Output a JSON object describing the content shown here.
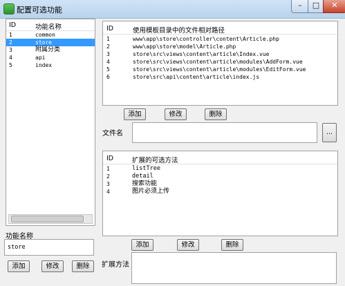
{
  "window": {
    "title": "配置可选功能"
  },
  "left_list": {
    "headers": {
      "id": "ID",
      "name": "功能名称"
    },
    "rows": [
      {
        "id": "1",
        "name": "common"
      },
      {
        "id": "2",
        "name": "store"
      },
      {
        "id": "3",
        "name": "附属分类"
      },
      {
        "id": "4",
        "name": "api"
      },
      {
        "id": "5",
        "name": "index"
      }
    ],
    "selected_index": 1
  },
  "left_form": {
    "name_label": "功能名称",
    "name_value": "store",
    "add_label": "添加",
    "edit_label": "修改",
    "delete_label": "删除"
  },
  "file_list": {
    "headers": {
      "id": "ID",
      "path": "使用模板目录中的文件相对路径"
    },
    "rows": [
      {
        "id": "1",
        "path": "www\\app\\store\\controller\\content\\Article.php"
      },
      {
        "id": "2",
        "path": "www\\app\\store\\model\\Article.php"
      },
      {
        "id": "3",
        "path": "store\\src\\views\\content\\article\\Index.vue"
      },
      {
        "id": "4",
        "path": "store\\src\\views\\content\\article\\modules\\AddForm.vue"
      },
      {
        "id": "5",
        "path": "store\\src\\views\\content\\article\\modules\\EditForm.vue"
      },
      {
        "id": "6",
        "path": "store\\src\\api\\content\\article\\index.js"
      }
    ],
    "add_label": "添加",
    "edit_label": "修改",
    "delete_label": "删除"
  },
  "file_form": {
    "label": "文件名",
    "value": "",
    "browse_label": "..."
  },
  "method_list": {
    "headers": {
      "id": "ID",
      "method": "扩展的可选方法"
    },
    "rows": [
      {
        "id": "1",
        "method": "listTree"
      },
      {
        "id": "2",
        "method": "detail"
      },
      {
        "id": "3",
        "method": "搜索功能"
      },
      {
        "id": "4",
        "method": "图片必须上传"
      }
    ],
    "add_label": "添加",
    "edit_label": "修改",
    "delete_label": "删除"
  },
  "method_form": {
    "label": "扩展方法",
    "value": ""
  }
}
